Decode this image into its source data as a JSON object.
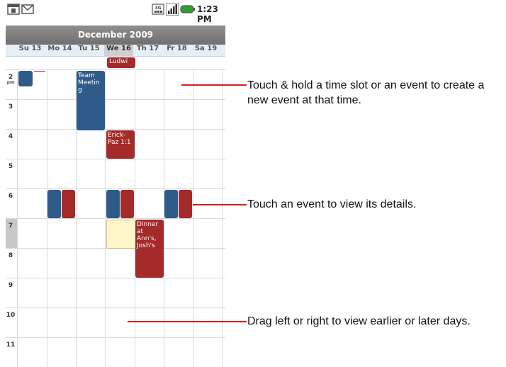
{
  "status_bar": {
    "time": "1:23 PM",
    "icons": [
      "calendar-app-icon",
      "gmail-icon",
      "3g-icon",
      "signal-icon",
      "battery-icon"
    ],
    "network_badge": "3G"
  },
  "calendar": {
    "month_title": "December 2009",
    "days": [
      {
        "label": "Su 13",
        "selected": false
      },
      {
        "label": "Mo 14",
        "selected": false
      },
      {
        "label": "Tu 15",
        "selected": false
      },
      {
        "label": "We 16",
        "selected": true
      },
      {
        "label": "Th 17",
        "selected": false
      },
      {
        "label": "Fr 18",
        "selected": false
      },
      {
        "label": "Sa 19",
        "selected": false
      }
    ],
    "hours": [
      "2",
      "3",
      "4",
      "5",
      "6",
      "7",
      "8",
      "9",
      "10",
      "11"
    ],
    "pm_label": "pm",
    "all_day_event": "Ludwi",
    "events": [
      {
        "text": "Team Meeting",
        "color": "#2f5b8b"
      },
      {
        "text": "Erick-Paz 1:1",
        "color": "#a52a2a"
      },
      {
        "text": "Dinner at Ann's, Josh's",
        "color": "#a52a2a"
      }
    ],
    "colors": {
      "blue_event": "#2f5b8b",
      "red_event": "#a52a2a",
      "header_bar": "#7f7f7f",
      "days_row": "#e6eef6",
      "selected_slot": "#fff6c8"
    }
  },
  "annotations": [
    {
      "text": "Touch & hold a time slot or an event to create a new event at that time."
    },
    {
      "text": "Touch an event to view its details."
    },
    {
      "text": "Drag left or right to view earlier or later days."
    }
  ],
  "annotation_color": "#d61f1f"
}
